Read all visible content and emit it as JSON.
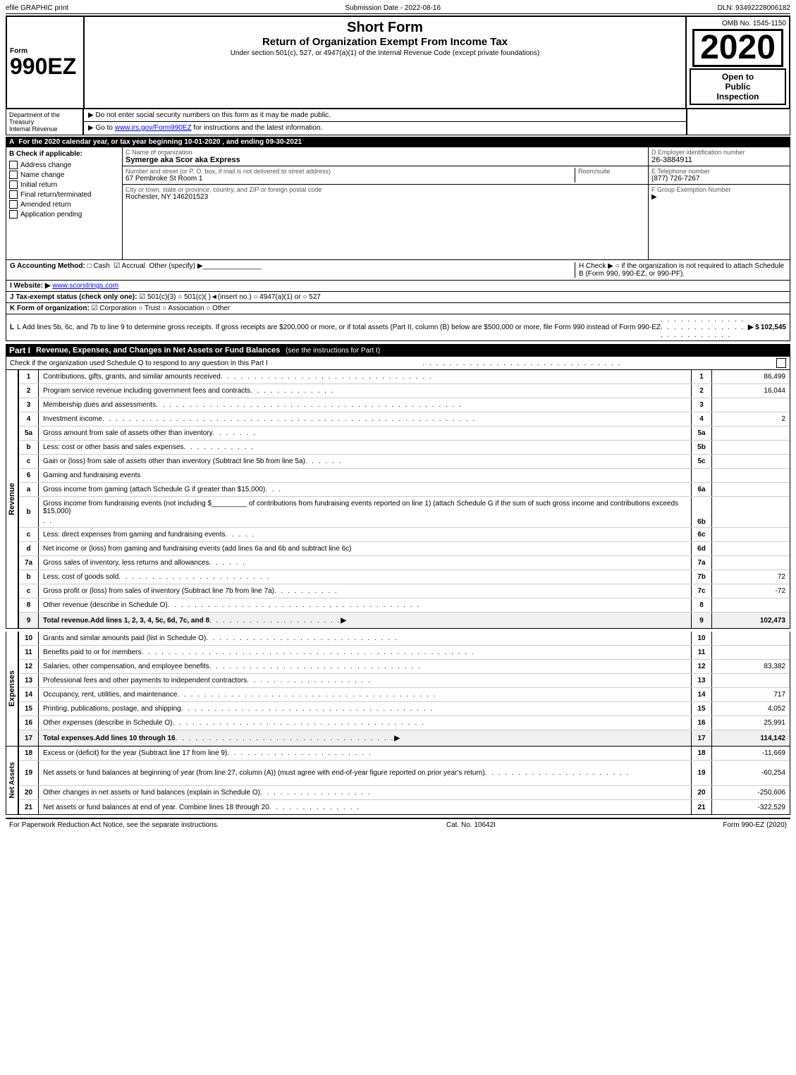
{
  "topBar": {
    "left": "efile GRAPHIC print",
    "mid": "Submission Date - 2022-08-16",
    "right": "DLN: 93492228006182"
  },
  "form": {
    "number": "990EZ",
    "subLabel": "Form",
    "title1": "Short Form",
    "title2": "Return of Organization Exempt From Income Tax",
    "subtitle": "Under section 501(c), 527, or 4947(a)(1) of the Internal Revenue Code (except private foundations)",
    "omb": "OMB No. 1545-1150",
    "year": "2020",
    "openLabel1": "Open to",
    "openLabel2": "Public",
    "openLabel3": "Inspection"
  },
  "instructions": {
    "line1": "▶ Do not enter social security numbers on this form as it may be made public.",
    "line2": "▶ Go to www.irs.gov/Form990EZ for instructions and the latest information."
  },
  "dept": {
    "line1": "Department of the",
    "line2": "Treasury",
    "line3": "Internal Revenue"
  },
  "sectionA": {
    "label": "A",
    "text": "For the 2020 calendar year, or tax year beginning 10-01-2020 , and ending 09-30-2021"
  },
  "checkB": {
    "label": "B Check if applicable:",
    "items": [
      {
        "id": "address",
        "label": "Address change",
        "checked": false
      },
      {
        "id": "name",
        "label": "Name change",
        "checked": false
      },
      {
        "id": "initial",
        "label": "Initial return",
        "checked": false
      },
      {
        "id": "final",
        "label": "Final return/terminated",
        "checked": false
      },
      {
        "id": "amended",
        "label": "Amended return",
        "checked": false
      },
      {
        "id": "pending",
        "label": "Application pending",
        "checked": false
      }
    ]
  },
  "orgInfo": {
    "nameLabel": "C Name of organization",
    "name": "Symerge aka Scor aka Express",
    "addressLabel": "Number and street (or P. O. box, if mail is not delivered to street address)",
    "address": "67 Pembroke St Room 1",
    "roomLabel": "Room/suite",
    "cityLabel": "City or town, state or province, country, and ZIP or foreign postal code",
    "city": "Rochester, NY  146201523",
    "einLabel": "D Employer identification number",
    "ein": "26-3884911",
    "phoneLabel": "E Telephone number",
    "phone": "(877) 726-7267",
    "groupLabel": "F Group Exemption Number",
    "groupNum": "▶"
  },
  "accounting": {
    "label": "G Accounting Method:",
    "cash": "□ Cash",
    "accrual": "☑ Accrual",
    "other": "Other (specify) ▶_______________",
    "hText": "H Check ▶  ○ if the organization is not required to attach Schedule B (Form 990, 990-EZ, or 990-PF)."
  },
  "website": {
    "label": "I Website: ▶",
    "url": "www.scorstrings.com"
  },
  "taxExempt": {
    "label": "J Tax-exempt status (check only one):",
    "options": "☑ 501(c)(3)  ○ 501(c)(   )◄(insert no.)  ○ 4947(a)(1) or  ○ 527"
  },
  "formOrg": {
    "label": "K Form of organization:",
    "options": "☑ Corporation  ○ Trust  ○ Association  ○ Other"
  },
  "lineL": {
    "text": "L Add lines 5b, 6c, and 7b to line 9 to determine gross receipts. If gross receipts are $200,000 or more, or if total assets (Part II, column (B) below are $500,000 or more, file Form 990 instead of Form 990-EZ",
    "dotted": ". . . . . . . . . . . . . . . . . . . . . . . . . . . . . . . . . . . . .",
    "arrow": "▶ $",
    "value": "102,545"
  },
  "partI": {
    "title": "Part I",
    "titleDesc": "Revenue, Expenses, and Changes in Net Assets or Fund Balances",
    "subtitle": "(see the instructions for Part I)",
    "checkText": "Check if the organization used Schedule O to respond to any question in this Part I",
    "lines": [
      {
        "num": "1",
        "desc": "Contributions, gifts, grants, and similar amounts received",
        "dots": true,
        "ref": "1",
        "value": "86,499"
      },
      {
        "num": "2",
        "desc": "Program service revenue including government fees and contracts",
        "dots": true,
        "ref": "2",
        "value": "16,044"
      },
      {
        "num": "3",
        "desc": "Membership dues and assessments",
        "dots": true,
        "ref": "3",
        "value": ""
      },
      {
        "num": "4",
        "desc": "Investment income",
        "dots": true,
        "ref": "4",
        "value": "2"
      },
      {
        "num": "5a",
        "desc": "Gross amount from sale of assets other than inventory",
        "ref": "5a",
        "value": ""
      },
      {
        "num": "5b",
        "desc": "Less: cost or other basis and sales expenses",
        "ref": "5b",
        "value": ""
      },
      {
        "num": "5c",
        "desc": "Gain or (loss) from sale of assets other than inventory (Subtract line 5b from line 5a)",
        "dots": true,
        "ref": "5c",
        "value": ""
      },
      {
        "num": "6",
        "desc": "Gaming and fundraising events",
        "ref": "",
        "value": ""
      },
      {
        "num": "6a",
        "sub": true,
        "desc": "Gross income from gaming (attach Schedule G if greater than $15,000)",
        "ref": "6a",
        "value": ""
      },
      {
        "num": "6b",
        "sub": true,
        "desc": "Gross income from fundraising events (not including $________ of contributions from fundraising events reported on line 1) (attach Schedule G if the sum of such gross income and contributions exceeds $15,000)",
        "ref": "6b",
        "value": ""
      },
      {
        "num": "6c",
        "sub": true,
        "desc": "Less: direct expenses from gaming and fundraising events",
        "ref": "6c",
        "value": ""
      },
      {
        "num": "6d",
        "desc": "Net income or (loss) from gaming and fundraising events (add lines 6a and 6b and subtract line 6c)",
        "ref": "6d",
        "value": ""
      },
      {
        "num": "7a",
        "desc": "Gross sales of inventory, less returns and allowances",
        "ref": "7a",
        "value": ""
      },
      {
        "num": "7b",
        "desc": "Less: cost of goods sold",
        "ref": "7b",
        "value": "72"
      },
      {
        "num": "7c",
        "desc": "Gross profit or (loss) from sales of inventory (Subtract line 7b from line 7a)",
        "dots": true,
        "ref": "7c",
        "value": "-72"
      },
      {
        "num": "8",
        "desc": "Other revenue (describe in Schedule O)",
        "dots": true,
        "ref": "8",
        "value": ""
      },
      {
        "num": "9",
        "desc": "Total revenue. Add lines 1, 2, 3, 4, 5c, 6d, 7c, and 8",
        "dots": true,
        "ref": "9",
        "value": "102,473",
        "total": true
      }
    ]
  },
  "expenses": {
    "lines": [
      {
        "num": "10",
        "desc": "Grants and similar amounts paid (list in Schedule O)",
        "dots": true,
        "ref": "10",
        "value": ""
      },
      {
        "num": "11",
        "desc": "Benefits paid to or for members",
        "dots": true,
        "ref": "11",
        "value": ""
      },
      {
        "num": "12",
        "desc": "Salaries, other compensation, and employee benefits",
        "dots": true,
        "ref": "12",
        "value": "83,382"
      },
      {
        "num": "13",
        "desc": "Professional fees and other payments to independent contractors",
        "dots": true,
        "ref": "13",
        "value": ""
      },
      {
        "num": "14",
        "desc": "Occupancy, rent, utilities, and maintenance",
        "dots": true,
        "ref": "14",
        "value": "717"
      },
      {
        "num": "15",
        "desc": "Printing, publications, postage, and shipping",
        "dots": true,
        "ref": "15",
        "value": "4,052"
      },
      {
        "num": "16",
        "desc": "Other expenses (describe in Schedule O)",
        "dots": true,
        "ref": "16",
        "value": "25,991"
      },
      {
        "num": "17",
        "desc": "Total expenses. Add lines 10 through 16",
        "dots": true,
        "ref": "17",
        "value": "114,142",
        "total": true
      }
    ]
  },
  "netAssets": {
    "lines": [
      {
        "num": "18",
        "desc": "Excess or (deficit) for the year (Subtract line 17 from line 9)",
        "dots": true,
        "ref": "18",
        "value": "-11,669"
      },
      {
        "num": "19",
        "desc": "Net assets or fund balances at beginning of year (from line 27, column (A)) (must agree with end-of-year figure reported on prior year's return)",
        "dots": true,
        "ref": "19",
        "value": "-60,254"
      },
      {
        "num": "20",
        "desc": "Other changes in net assets or fund balances (explain in Schedule O)",
        "dots": true,
        "ref": "20",
        "value": "-250,606"
      },
      {
        "num": "21",
        "desc": "Net assets or fund balances at end of year. Combine lines 18 through 20",
        "dots": true,
        "ref": "21",
        "value": "-322,529"
      }
    ]
  },
  "footer": {
    "left": "For Paperwork Reduction Act Notice, see the separate instructions.",
    "mid": "Cat. No. 10642I",
    "right": "Form 990-EZ (2020)"
  }
}
